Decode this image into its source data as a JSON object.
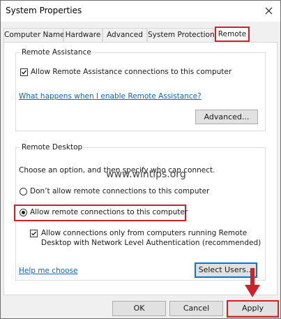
{
  "window": {
    "title": "System Properties",
    "close_icon": "close-icon"
  },
  "tabs": [
    {
      "label": "Computer Name"
    },
    {
      "label": "Hardware"
    },
    {
      "label": "Advanced"
    },
    {
      "label": "System Protection"
    },
    {
      "label": "Remote",
      "active": true
    }
  ],
  "remote_assistance": {
    "legend": "Remote Assistance",
    "allow_label": "Allow Remote Assistance connections to this computer",
    "allow_checked": true,
    "help_link": "What happens when I enable Remote Assistance?",
    "advanced_button": "Advanced..."
  },
  "remote_desktop": {
    "legend": "Remote Desktop",
    "instruction": "Choose an option, and then specify who can connect.",
    "options": [
      {
        "label": "Don’t allow remote connections to this computer",
        "selected": false
      },
      {
        "label": "Allow remote connections to this computer",
        "selected": true
      }
    ],
    "nla_line1": "Allow connections only from computers running Remote",
    "nla_line2": "Desktop with Network Level Authentication (recommended)",
    "nla_checked": true,
    "help_link": "Help me choose",
    "select_users_button": "Select Users..."
  },
  "watermark": "www.wintips.org",
  "footer": {
    "ok": "OK",
    "cancel": "Cancel",
    "apply": "Apply"
  },
  "colors": {
    "highlight": "#d0202a",
    "link": "#0a64c8",
    "focus": "#0078d7"
  }
}
